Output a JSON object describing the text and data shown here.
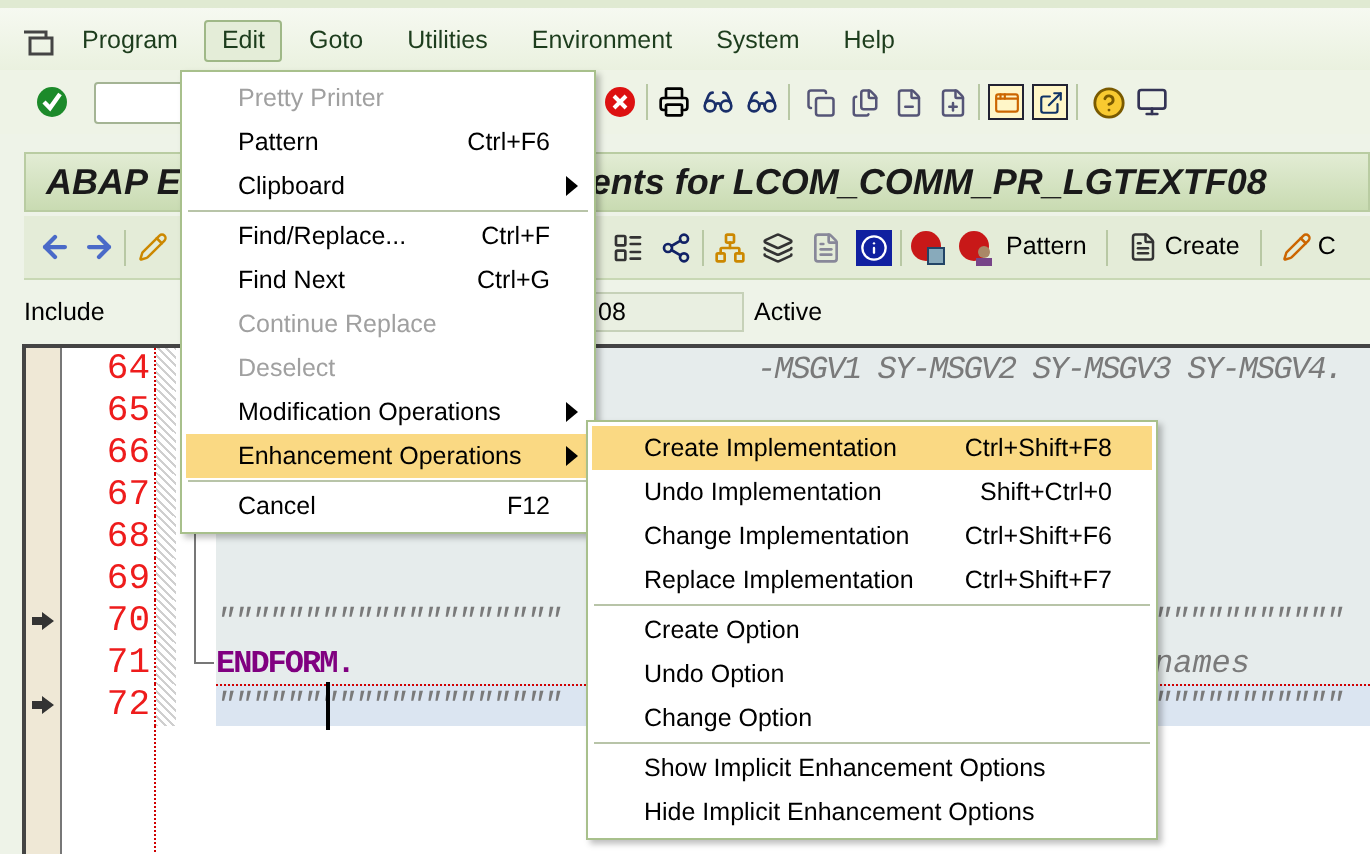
{
  "menubar": [
    {
      "label": "Program",
      "selected": false
    },
    {
      "label": "Edit",
      "selected": true
    },
    {
      "label": "Goto",
      "selected": false
    },
    {
      "label": "Utilities",
      "selected": false
    },
    {
      "label": "Environment",
      "selected": false
    },
    {
      "label": "System",
      "selected": false
    },
    {
      "label": "Help",
      "selected": false
    }
  ],
  "title_parts": [
    "ABAP E",
    "ents for LCOM_COMM_PR_LGTEXTF08"
  ],
  "app_toolbar": {
    "buttons": [
      {
        "label": "Pattern",
        "kind": "plain"
      },
      {
        "label": "Create",
        "kind": "page"
      },
      {
        "label": "C",
        "kind": "pencil"
      }
    ]
  },
  "include": {
    "label": "Include",
    "value": "08",
    "status": "Active"
  },
  "editor": {
    "lines": [
      {
        "number": "64",
        "marked": false,
        "current": false,
        "kind": "comment",
        "trailing": "-MSGV1 SY-MSGV2 SY-MSGV3 SY-MSGV4."
      },
      {
        "number": "65",
        "marked": false,
        "current": false,
        "kind": "comment"
      },
      {
        "number": "66",
        "marked": false,
        "current": false,
        "kind": "comment"
      },
      {
        "number": "67",
        "marked": false,
        "current": false,
        "kind": "comment"
      },
      {
        "number": "68",
        "marked": false,
        "current": false,
        "kind": "comment"
      },
      {
        "number": "69",
        "marked": false,
        "current": false,
        "kind": "comment"
      },
      {
        "number": "70",
        "marked": true,
        "current": false,
        "kind": "comment",
        "text": "\"\"\"\"\"\"\"\"\"\"\"\"\"\"\"\"\"\"\"\"",
        "trailing": "\"\"\"\"\"\"\"\"\"\"\""
      },
      {
        "number": "71",
        "marked": false,
        "current": false,
        "kind": "keyword",
        "text": "ENDFORM.",
        "trailing": "names"
      },
      {
        "number": "72",
        "marked": true,
        "current": true,
        "kind": "comment",
        "text": "\"\"\"\"\"\"\"\"\"\"\"\"\"\"\"\"\"\"\"\"",
        "trailing": "\"\"\"\"\"\"\"\"\"\"\""
      }
    ]
  },
  "edit_menu": {
    "items": [
      {
        "kind": "item",
        "label": "Pretty Printer",
        "disabled": true,
        "submenu": false,
        "selected": false
      },
      {
        "kind": "item",
        "label": "Pattern",
        "shortcut": "Ctrl+F6",
        "disabled": false,
        "submenu": false,
        "selected": false
      },
      {
        "kind": "item",
        "label": "Clipboard",
        "disabled": false,
        "submenu": true,
        "selected": false
      },
      {
        "kind": "separator"
      },
      {
        "kind": "item",
        "label": "Find/Replace...",
        "shortcut": "Ctrl+F",
        "disabled": false,
        "submenu": false,
        "selected": false
      },
      {
        "kind": "item",
        "label": "Find Next",
        "shortcut": "Ctrl+G",
        "disabled": false,
        "submenu": false,
        "selected": false
      },
      {
        "kind": "item",
        "label": "Continue Replace",
        "disabled": true,
        "submenu": false,
        "selected": false
      },
      {
        "kind": "item",
        "label": "Deselect",
        "disabled": true,
        "submenu": false,
        "selected": false
      },
      {
        "kind": "item",
        "label": "Modification Operations",
        "disabled": false,
        "submenu": true,
        "selected": false
      },
      {
        "kind": "item",
        "label": "Enhancement Operations",
        "disabled": false,
        "submenu": true,
        "selected": true
      },
      {
        "kind": "separator"
      },
      {
        "kind": "item",
        "label": "Cancel",
        "shortcut": "F12",
        "disabled": false,
        "submenu": false,
        "selected": false
      }
    ]
  },
  "submenu": {
    "items": [
      {
        "kind": "item",
        "label": "Create Implementation",
        "shortcut": "Ctrl+Shift+F8",
        "disabled": false,
        "submenu": false,
        "selected": true
      },
      {
        "kind": "item",
        "label": "Undo Implementation",
        "shortcut": "Shift+Ctrl+0",
        "disabled": false,
        "submenu": false,
        "selected": false
      },
      {
        "kind": "item",
        "label": "Change Implementation",
        "shortcut": "Ctrl+Shift+F6",
        "disabled": false,
        "submenu": false,
        "selected": false
      },
      {
        "kind": "item",
        "label": "Replace Implementation",
        "shortcut": "Ctrl+Shift+F7",
        "disabled": false,
        "submenu": false,
        "selected": false
      },
      {
        "kind": "separator"
      },
      {
        "kind": "item",
        "label": "Create Option",
        "disabled": false,
        "submenu": false,
        "selected": false
      },
      {
        "kind": "item",
        "label": "Undo Option",
        "disabled": false,
        "submenu": false,
        "selected": false
      },
      {
        "kind": "item",
        "label": "Change Option",
        "disabled": false,
        "submenu": false,
        "selected": false
      },
      {
        "kind": "separator"
      },
      {
        "kind": "item",
        "label": "Show Implicit Enhancement Options",
        "disabled": false,
        "submenu": false,
        "selected": false
      },
      {
        "kind": "item",
        "label": "Hide Implicit Enhancement Options",
        "disabled": false,
        "submenu": false,
        "selected": false
      }
    ]
  }
}
